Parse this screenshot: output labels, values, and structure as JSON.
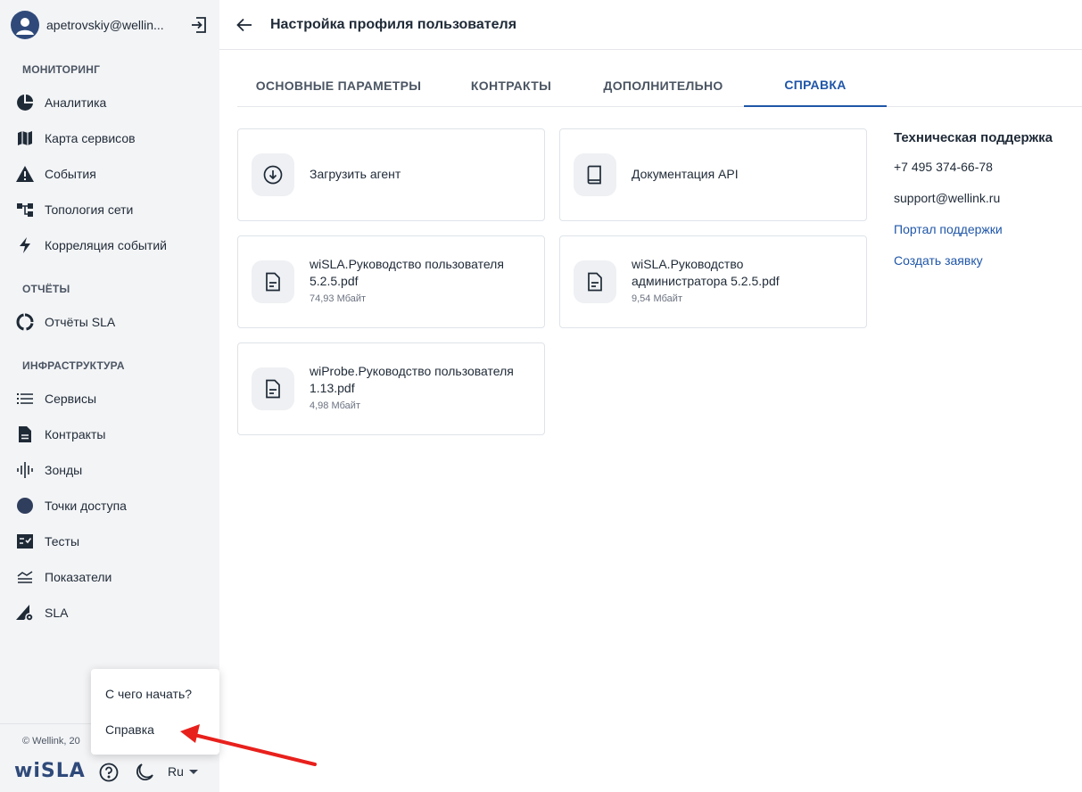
{
  "sidebar": {
    "user": {
      "name": "apetrovskiy@wellin..."
    },
    "sections": {
      "monitoring": "МОНИТОРИНГ",
      "reports": "ОТЧЁТЫ",
      "infrastructure": "ИНФРАСТРУКТУРА"
    },
    "items": {
      "analytics": "Аналитика",
      "service_map": "Карта сервисов",
      "events": "События",
      "topology": "Топология сети",
      "correlation": "Корреляция событий",
      "sla_reports": "Отчёты SLA",
      "services": "Сервисы",
      "contracts": "Контракты",
      "probes": "Зонды",
      "access_points": "Точки доступа",
      "tests": "Тесты",
      "metrics": "Показатели",
      "sla": "SLA"
    },
    "footer": {
      "copyright": "© Wellink, 20",
      "logo": "wiSLA",
      "language": "Ru"
    }
  },
  "popup": {
    "getting_started": "С чего начать?",
    "help": "Справка"
  },
  "header": {
    "title": "Настройка профиля пользователя"
  },
  "tabs": {
    "main": "ОСНОВНЫЕ ПАРАМЕТРЫ",
    "contracts": "КОНТРАКТЫ",
    "additional": "ДОПОЛНИТЕЛЬНО",
    "help": "СПРАВКА"
  },
  "cards": {
    "download_agent": {
      "title": "Загрузить агент"
    },
    "api_docs": {
      "title": "Документация API"
    },
    "user_guide": {
      "title_line1": "wiSLA.Руководство пользователя",
      "title_line2": "5.2.5.pdf",
      "size": "74,93 Мбайт"
    },
    "admin_guide": {
      "title_line1": "wiSLA.Руководство",
      "title_line2": "администратора 5.2.5.pdf",
      "size": "9,54 Мбайт"
    },
    "probe_guide": {
      "title_line1": "wiProbe.Руководство пользователя",
      "title_line2": "1.13.pdf",
      "size": "4,98 Мбайт"
    }
  },
  "support": {
    "title": "Техническая поддержка",
    "phone": "+7 495 374-66-78",
    "email": "support@wellink.ru",
    "portal_link": "Портал поддержки",
    "ticket_link": "Создать заявку"
  },
  "colors": {
    "accent": "#1f56a8",
    "sidebar_bg": "#f3f4f6",
    "icon_dark": "#2f4a7a",
    "annotation_arrow": "#e8201c"
  }
}
